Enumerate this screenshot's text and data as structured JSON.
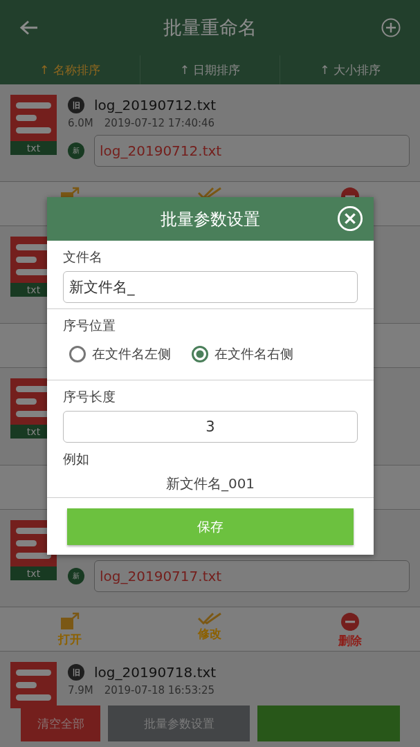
{
  "header": {
    "title": "批量重命名"
  },
  "sort_tabs": [
    {
      "label": "↑ 名称排序",
      "selected": true
    },
    {
      "label": "↑ 日期排序",
      "selected": false
    },
    {
      "label": "↑ 大小排序",
      "selected": false
    }
  ],
  "files": [
    {
      "type_label": "txt",
      "old_badge": "旧",
      "old_name": "log_20190712.txt",
      "size": "6.0M",
      "date": "2019-07-12 17:40:46",
      "new_badge": "新",
      "new_name": "log_20190712.txt",
      "actions": [
        {
          "kind": "open"
        },
        {
          "kind": "edit"
        },
        {
          "kind": "delete"
        }
      ]
    },
    {
      "type_label": "txt"
    },
    {
      "type_label": "txt"
    },
    {
      "type_label": "txt",
      "new_badge": "新",
      "new_name": "log_20190717.txt",
      "actions": [
        {
          "kind": "open",
          "label": "打开"
        },
        {
          "kind": "edit",
          "label": "修改"
        },
        {
          "kind": "delete",
          "label": "删除"
        }
      ]
    },
    {
      "old_badge": "旧",
      "old_name": "log_20190718.txt",
      "size": "7.9M",
      "date": "2019-07-18 16:53:25"
    }
  ],
  "bottom_buttons": [
    {
      "kind": "clear",
      "label": "清空全部"
    },
    {
      "kind": "settings",
      "label": "批量参数设置"
    },
    {
      "kind": "confirm"
    }
  ],
  "dialog": {
    "title": "批量参数设置",
    "filename_label": "文件名",
    "filename_value": "新文件名_",
    "position_label": "序号位置",
    "positions": [
      {
        "label": "在文件名左侧",
        "selected": false
      },
      {
        "label": "在文件名右侧",
        "selected": true
      }
    ],
    "length_label": "序号长度",
    "length_value": "3",
    "example_label": "例如",
    "example_value": "新文件名_001",
    "save_label": "保存"
  }
}
